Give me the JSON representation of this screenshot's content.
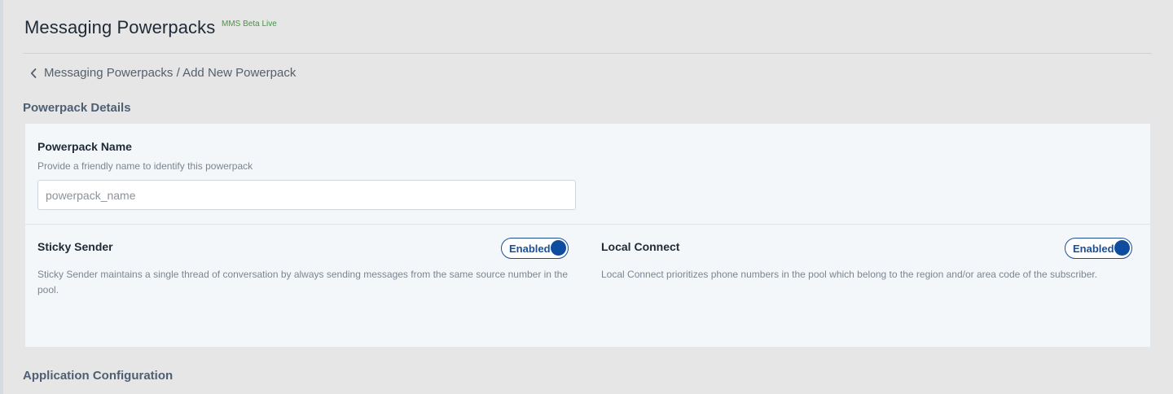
{
  "header": {
    "title": "Messaging Powerpacks",
    "badge": "MMS Beta Live"
  },
  "breadcrumb": {
    "text": "Messaging Powerpacks / Add New Powerpack",
    "icon": "chevron-left-icon"
  },
  "sections": {
    "details_title": "Powerpack Details",
    "app_config_title": "Application Configuration"
  },
  "powerpack_name": {
    "label": "Powerpack Name",
    "help": "Provide a friendly name to identify this powerpack",
    "placeholder": "powerpack_name",
    "value": ""
  },
  "sticky_sender": {
    "title": "Sticky Sender",
    "toggle_label": "Enabled",
    "enabled": true,
    "description": "Sticky Sender maintains a single thread of conversation by always sending messages from the same source number in the pool."
  },
  "local_connect": {
    "title": "Local Connect",
    "toggle_label": "Enabled",
    "enabled": true,
    "description": "Local Connect prioritizes phone numbers in the pool which belong to the region and/or area code of the subscriber."
  },
  "colors": {
    "background": "#e6e6e6",
    "card": "#f4f7fa",
    "accent": "#0d4c9f",
    "badge": "#3f9a3a"
  }
}
